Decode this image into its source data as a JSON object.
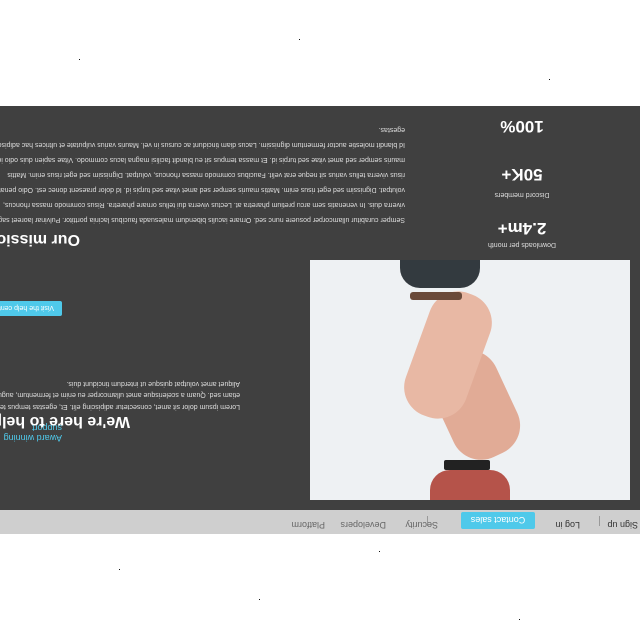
{
  "nav": {
    "links": [
      "Platform",
      "Developers",
      "Security"
    ],
    "contact_label": "Contact sales",
    "login_label": "Log in",
    "signup_label": "Sign up"
  },
  "hero": {
    "kicker": "Award winning support",
    "title": "We're here to help",
    "body": "Lorem ipsum dolor sit amet, consectetur adipiscing elit. Et, egestas tempus tellus etiam sed. Quam a scelerisque amet ullamcorper eu enim et fermentum, augue. Aliquet amet volutpat quisque ut interdum tincidunt duis.",
    "button_label": "Visit the help center"
  },
  "mission": {
    "title": "Our mission",
    "body": "Semper curabitur ullamcorper posuere nunc sed. Ornare iaculis bibendum malesuada faucibus lacinia porttitor. Pulvinar laoreet sagittis viverra duis. In venenatis sem arcu pretium pharetra at. Lectus viverra dui tellus ornare pharetra. Risus commodo massa rhoncus, volutpat. Dignissim sed eget risus enim. Mattis mauris semper sed amet vitae sed turpis id. Id dolor praesent donec est. Odio penatibus risus viverra tellus varius sit neque erat velit. Faucibus commodo massa rhoncus, volutpat. Dignissim sed eget risus enim. Mattis mauris semper sed amet vitae sed turpis id. Et massa tempus sit eu blandit facilisi magna lacus commodo. Vitae sapien duis odio id et. Id blandit molestie auctor fermentum dignissim. Lacus diam tincidunt ac cursus in vel. Mauris varius vulputate et ultrices hac adipiscing egestas."
  },
  "stats": [
    {
      "value": "2.4m+",
      "label": "Downloads per month"
    },
    {
      "value": "50K+",
      "label": "Discord members"
    },
    {
      "value": "100%",
      "label": ""
    }
  ],
  "colors": {
    "accent": "#4fc9ea",
    "dark": "#404040",
    "nav": "#cfcfcf"
  }
}
